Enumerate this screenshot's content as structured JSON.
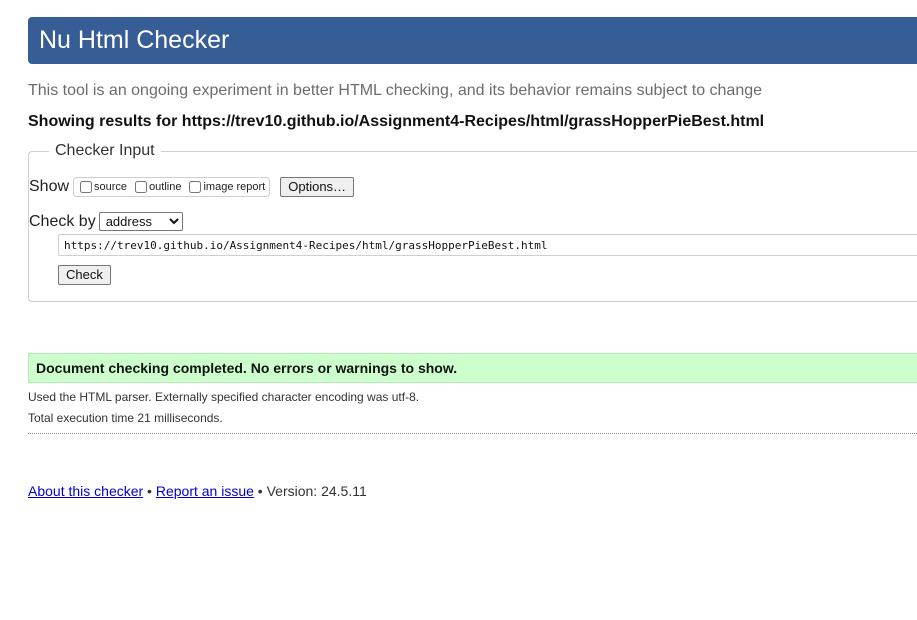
{
  "header": {
    "title": "Nu Html Checker"
  },
  "intro": {
    "text": "This tool is an ongoing experiment in better HTML checking, and its behavior remains subject to change"
  },
  "results": {
    "heading": "Showing results for https://trev10.github.io/Assignment4-Recipes/html/grassHopperPieBest.html"
  },
  "checker_input": {
    "legend": "Checker Input",
    "show_label": "Show",
    "show_options": [
      {
        "label": "source",
        "checked": false
      },
      {
        "label": "outline",
        "checked": false
      },
      {
        "label": "image report",
        "checked": false
      }
    ],
    "options_button": "Options…",
    "check_by_label": "Check by",
    "check_by_selected": "address",
    "url_value": "https://trev10.github.io/Assignment4-Recipes/html/grassHopperPieBest.html",
    "check_button": "Check"
  },
  "status": {
    "message": "Document checking completed. No errors or warnings to show.",
    "color": "#ccffcc"
  },
  "details": {
    "parser": "Used the HTML parser. Externally specified character encoding was utf-8.",
    "time": "Total execution time 21 milliseconds."
  },
  "footer": {
    "about_link": "About this checker",
    "separator": " • ",
    "report_link": "Report an issue",
    "version_text": "Version: 24.5.11"
  },
  "colors": {
    "header_bg": "#365d95",
    "link": "#0000cc"
  }
}
